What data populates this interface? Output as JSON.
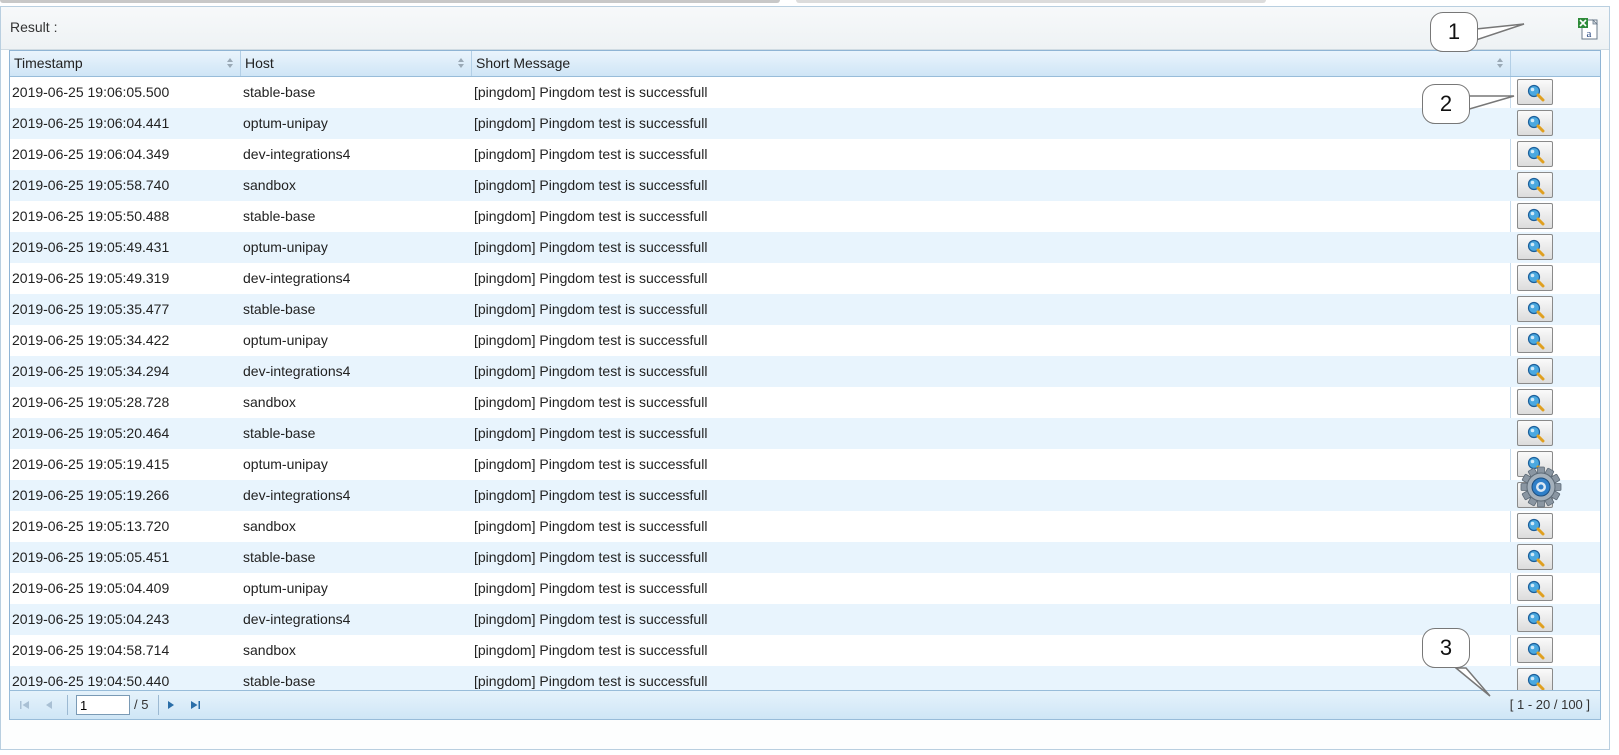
{
  "panel": {
    "title": "Result :",
    "excel_icon": "excel-export-icon"
  },
  "table": {
    "columns": [
      "Timestamp",
      "Host",
      "Short Message"
    ],
    "rows": [
      {
        "timestamp": "2019-06-25 19:06:05.500",
        "host": "stable-base",
        "message": "[pingdom] Pingdom test is successfull"
      },
      {
        "timestamp": "2019-06-25 19:06:04.441",
        "host": "optum-unipay",
        "message": "[pingdom] Pingdom test is successfull"
      },
      {
        "timestamp": "2019-06-25 19:06:04.349",
        "host": "dev-integrations4",
        "message": "[pingdom] Pingdom test is successfull"
      },
      {
        "timestamp": "2019-06-25 19:05:58.740",
        "host": "sandbox",
        "message": "[pingdom] Pingdom test is successfull"
      },
      {
        "timestamp": "2019-06-25 19:05:50.488",
        "host": "stable-base",
        "message": "[pingdom] Pingdom test is successfull"
      },
      {
        "timestamp": "2019-06-25 19:05:49.431",
        "host": "optum-unipay",
        "message": "[pingdom] Pingdom test is successfull"
      },
      {
        "timestamp": "2019-06-25 19:05:49.319",
        "host": "dev-integrations4",
        "message": "[pingdom] Pingdom test is successfull"
      },
      {
        "timestamp": "2019-06-25 19:05:35.477",
        "host": "stable-base",
        "message": "[pingdom] Pingdom test is successfull"
      },
      {
        "timestamp": "2019-06-25 19:05:34.422",
        "host": "optum-unipay",
        "message": "[pingdom] Pingdom test is successfull"
      },
      {
        "timestamp": "2019-06-25 19:05:34.294",
        "host": "dev-integrations4",
        "message": "[pingdom] Pingdom test is successfull"
      },
      {
        "timestamp": "2019-06-25 19:05:28.728",
        "host": "sandbox",
        "message": "[pingdom] Pingdom test is successfull"
      },
      {
        "timestamp": "2019-06-25 19:05:20.464",
        "host": "stable-base",
        "message": "[pingdom] Pingdom test is successfull"
      },
      {
        "timestamp": "2019-06-25 19:05:19.415",
        "host": "optum-unipay",
        "message": "[pingdom] Pingdom test is successfull"
      },
      {
        "timestamp": "2019-06-25 19:05:19.266",
        "host": "dev-integrations4",
        "message": "[pingdom] Pingdom test is successfull"
      },
      {
        "timestamp": "2019-06-25 19:05:13.720",
        "host": "sandbox",
        "message": "[pingdom] Pingdom test is successfull"
      },
      {
        "timestamp": "2019-06-25 19:05:05.451",
        "host": "stable-base",
        "message": "[pingdom] Pingdom test is successfull"
      },
      {
        "timestamp": "2019-06-25 19:05:04.409",
        "host": "optum-unipay",
        "message": "[pingdom] Pingdom test is successfull"
      },
      {
        "timestamp": "2019-06-25 19:05:04.243",
        "host": "dev-integrations4",
        "message": "[pingdom] Pingdom test is successfull"
      },
      {
        "timestamp": "2019-06-25 19:04:58.714",
        "host": "sandbox",
        "message": "[pingdom] Pingdom test is successfull"
      },
      {
        "timestamp": "2019-06-25 19:04:50.440",
        "host": "stable-base",
        "message": "[pingdom] Pingdom test is successfull"
      }
    ],
    "row_button_icon": "magnifier-details-icon"
  },
  "pager": {
    "page": "1",
    "total_pages": "/ 5",
    "range": "[ 1 - 20 / 100 ]",
    "icons": [
      "first-page-icon",
      "prev-page-icon",
      "next-page-icon",
      "last-page-icon"
    ]
  },
  "callouts": [
    "1",
    "2",
    "3"
  ],
  "floating": {
    "icon": "gear-icon"
  },
  "colors": {
    "header_bg": "#cfe5f6",
    "row_alt": "#e8f4fd",
    "border": "#8fb4d4"
  }
}
